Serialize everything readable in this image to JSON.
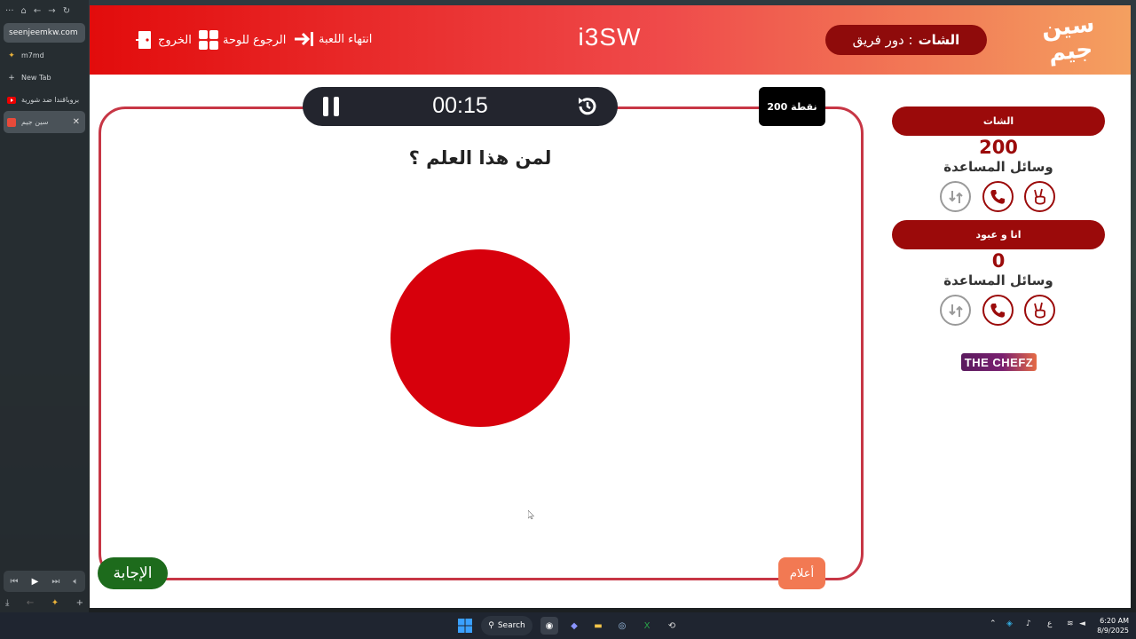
{
  "browser": {
    "address": "seenjeemkw.com",
    "tabs": [
      {
        "label": "m7md",
        "icon": "sparkle-icon"
      },
      {
        "label": "New Tab",
        "icon": "plus-icon"
      },
      {
        "label": "بروباقندا ضد شورية",
        "icon": "youtube-icon"
      },
      {
        "label": "سين جيم",
        "icon": "site-icon",
        "active": true
      }
    ]
  },
  "header": {
    "logo_text": "سين جيم",
    "turn_label": "دور فريق :",
    "turn_team": "الشات",
    "brand": "i3SW",
    "nav": {
      "end_game": "انتهاء اللعبة",
      "back_to_board": "الرجوع للوحة",
      "exit": "الخروج"
    }
  },
  "question": {
    "timer": "00:15",
    "points": "200 نقطة",
    "text": "لمن هذا العلم ؟",
    "answer_button": "الإجابة",
    "tell_button": "أعلام"
  },
  "teams": [
    {
      "name": "الشات",
      "score": "200",
      "helpers_label": "وسائل المساعدة"
    },
    {
      "name": "انا و عبود",
      "score": "0",
      "helpers_label": "وسائل المساعدة"
    }
  ],
  "sponsor": "THE CHEFZ",
  "taskbar": {
    "search": "Search",
    "lang": "ع",
    "time": "6:20 AM",
    "date": "8/9/2025"
  },
  "colors": {
    "header_red": "#e20c0c",
    "header_orange": "#f4a060",
    "team_pill": "#9b0a0a",
    "answer_green": "#1d6b1c",
    "tell_orange": "#f27953",
    "flag_red": "#d7000c"
  }
}
